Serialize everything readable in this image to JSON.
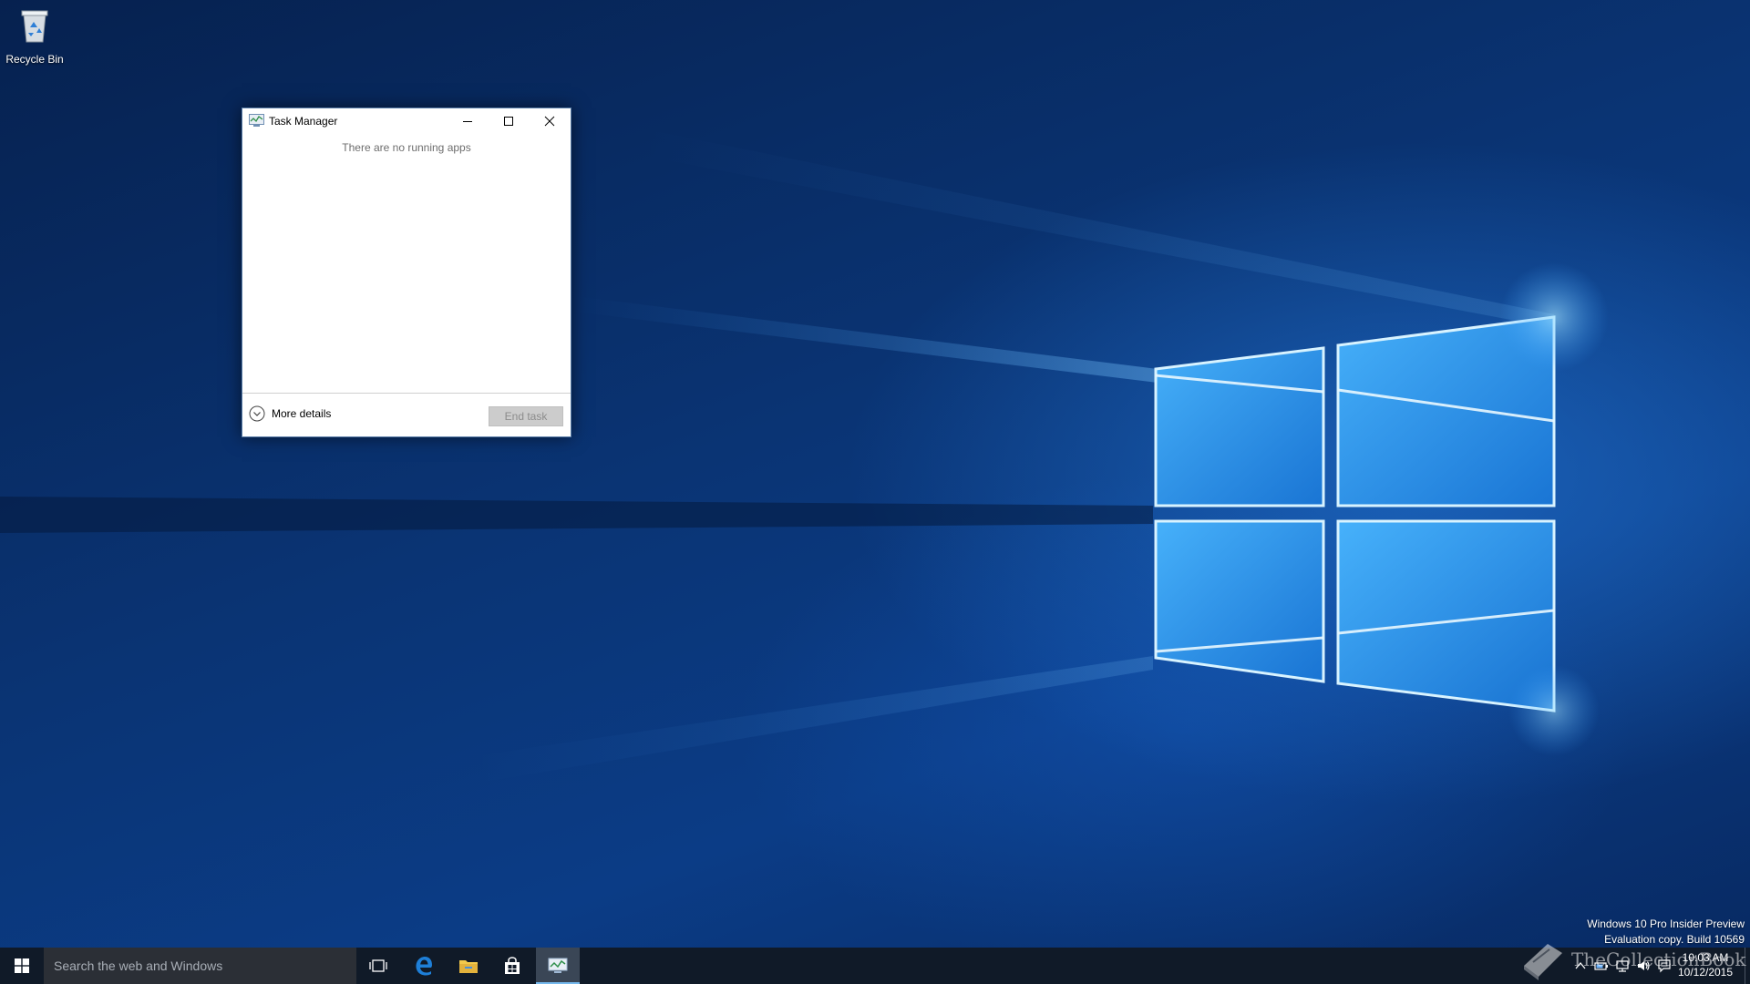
{
  "desktop": {
    "icons": [
      {
        "label": "Recycle Bin"
      }
    ]
  },
  "task_manager": {
    "title": "Task Manager",
    "empty_message": "There are no running apps",
    "more_details_label": "More details",
    "end_task_label": "End task"
  },
  "watermark": {
    "line1": "Windows 10 Pro Insider Preview",
    "line2": "Evaluation copy. Build 10569"
  },
  "site_watermark": "TheCollectionBook",
  "taskbar": {
    "search_placeholder": "Search the web and Windows",
    "apps": [
      "task-view",
      "microsoft-edge",
      "file-explorer",
      "store",
      "task-manager"
    ],
    "clock": {
      "time": "10:03 AM",
      "date": "10/12/2015"
    }
  },
  "colors": {
    "taskbar_bg": "#101a28",
    "search_bg": "#2b2f36",
    "active_underline": "#76b9ed",
    "edge_blue": "#1e7fd8",
    "explorer_yellow": "#f2c94c"
  }
}
